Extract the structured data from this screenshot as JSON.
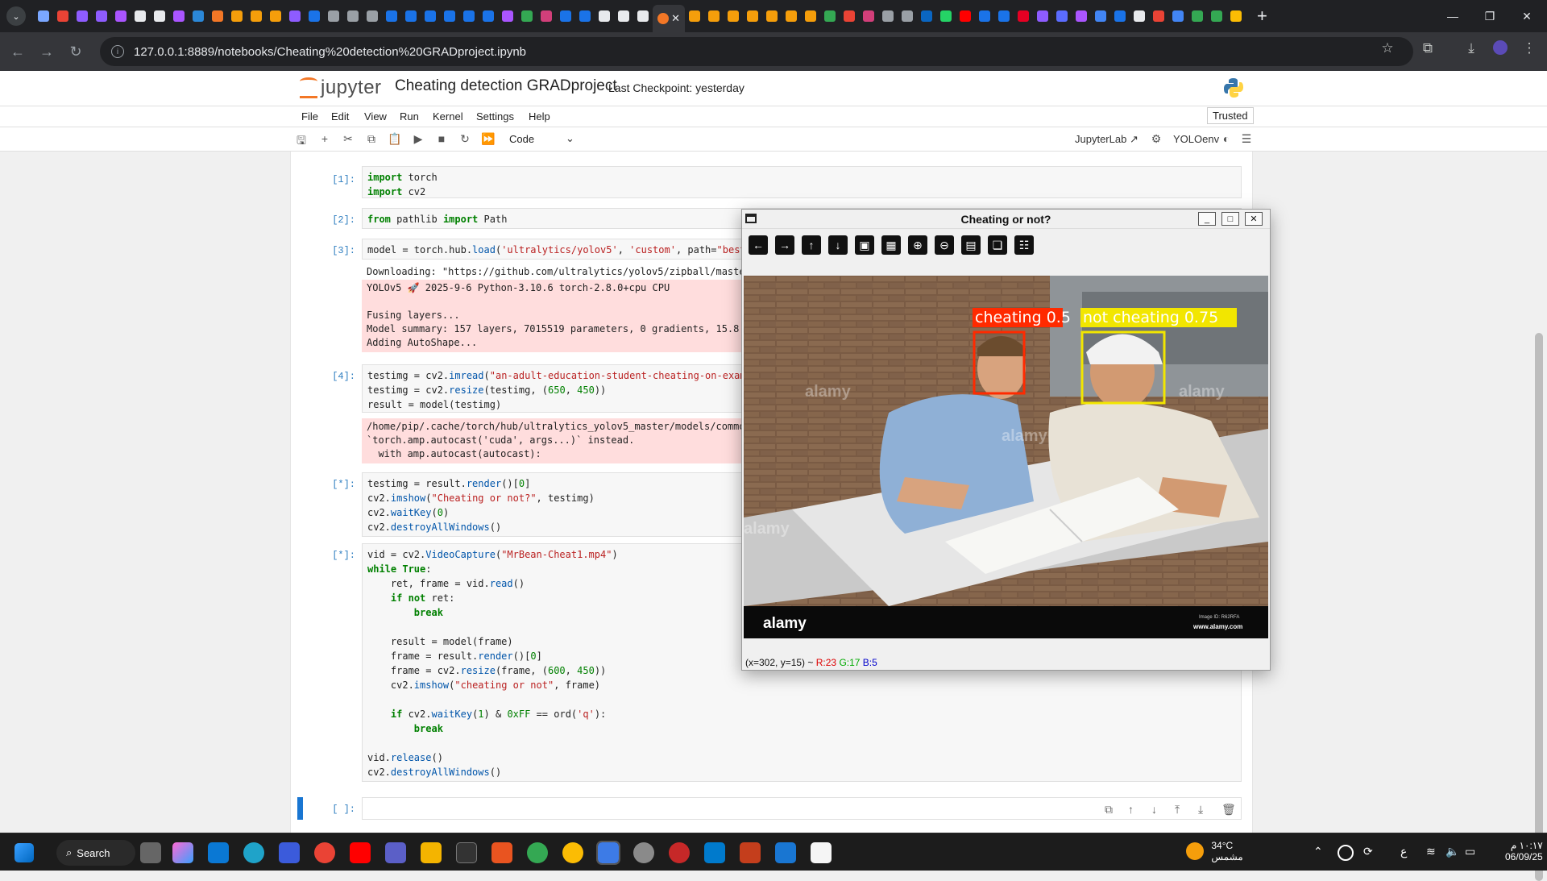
{
  "browser": {
    "url": "127.0.0.1:8889/notebooks/Cheating%20detection%20GRADproject.ipynb",
    "tab_icons": [
      "#7aa7ff",
      "#ea4335",
      "#8e5cff",
      "#8e5cff",
      "#aa55ff",
      "#e8eaed",
      "#e8eaed",
      "#aa55ff",
      "#2b88d8",
      "#f37726",
      "#f59e0b",
      "#f59e0b",
      "#f59e0b",
      "#8e5cff",
      "#1a73e8",
      "#9aa0a6",
      "#9aa0a6",
      "#9aa0a6",
      "#1a73e8",
      "#1a73e8",
      "#1a73e8",
      "#1a73e8",
      "#1a73e8",
      "#1a73e8",
      "#aa55ff",
      "#34a853",
      "#d23f7a",
      "#1a73e8",
      "#1a73e8",
      "#e8eaed",
      "#e8eaed",
      "#e8eaed"
    ],
    "right_tab_icons": [
      "#f59e0b",
      "#f59e0b",
      "#f59e0b",
      "#f59e0b",
      "#f59e0b",
      "#f59e0b",
      "#f59e0b",
      "#34a853",
      "#ea4335",
      "#d23f7a",
      "#9aa0a6",
      "#9aa0a6",
      "#0a66c2",
      "#25d366",
      "#ff0000",
      "#1a73e8",
      "#1a73e8",
      "#e60023",
      "#8e5cff",
      "#5b6cff",
      "#aa55ff",
      "#4285f4",
      "#1a73e8",
      "#e8eaed",
      "#ea4335",
      "#4285f4",
      "#34a853",
      "#34a853",
      "#fbbc04"
    ]
  },
  "jupyter": {
    "logo_text": "jupyter",
    "notebook_title": "Cheating detection GRADproject",
    "checkpoint": "Last Checkpoint: yesterday",
    "menus": [
      "File",
      "Edit",
      "View",
      "Run",
      "Kernel",
      "Settings",
      "Help"
    ],
    "trusted": "Trusted",
    "cell_type": "Code",
    "jupyterlab_link": "JupyterLab",
    "kernel_name": "YOLOenv"
  },
  "cells": {
    "c1": {
      "prompt": "[1]:",
      "code": [
        "import torch",
        "import cv2"
      ]
    },
    "c2": {
      "prompt": "[2]:",
      "code": [
        "from pathlib import Path"
      ]
    },
    "c3": {
      "prompt": "[3]:",
      "code": "model = torch.hub.load('ultralytics/yolov5', 'custom', path=\"best",
      "out_download": "Downloading: \"https://github.com/ultralytics/yolov5/zipball/maste",
      "out_lines": [
        "YOLOv5 🚀 2025-9-6 Python-3.10.6 torch-2.8.0+cpu CPU",
        "",
        "Fusing layers...",
        "Model summary: 157 layers, 7015519 parameters, 0 gradients, 15.8",
        "Adding AutoShape..."
      ]
    },
    "c4": {
      "prompt": "[4]:",
      "code": [
        "testimg = cv2.imread(\"an-adult-education-student-cheating-on-exam",
        "testimg = cv2.resize(testimg, (650, 450))",
        "result = model(testimg)"
      ],
      "out_lines": [
        "/home/pip/.cache/torch/hub/ultralytics_yolov5_master/models/commo",
        "`torch.amp.autocast('cuda', args...)` instead.",
        "  with amp.autocast(autocast):"
      ]
    },
    "c5": {
      "prompt": "[*]:",
      "code": [
        "testimg = result.render()[0]",
        "cv2.imshow(\"Cheating or not?\", testimg)",
        "cv2.waitKey(0)",
        "cv2.destroyAllWindows()"
      ]
    },
    "c6": {
      "prompt": "[*]:",
      "code": [
        "vid = cv2.VideoCapture(\"MrBean-Cheat1.mp4\")",
        "while True:",
        "    ret, frame = vid.read()",
        "    if not ret:",
        "        break",
        "",
        "    result = model(frame)",
        "    frame = result.render()[0]",
        "    frame = cv2.resize(frame, (600, 450))",
        "    cv2.imshow(\"cheating or not\", frame)",
        "",
        "    if cv2.waitKey(1) & 0xFF == ord('q'):",
        "        break",
        "",
        "vid.release()",
        "cv2.destroyAllWindows()"
      ]
    },
    "c7": {
      "prompt": "[ ]:"
    }
  },
  "cv_window": {
    "title": "Cheating or not?",
    "tool_icons": [
      "arrow-left-icon",
      "arrow-right-icon",
      "arrow-up-icon",
      "arrow-down-icon",
      "image-icon",
      "image-settings-icon",
      "zoom-in-icon",
      "zoom-out-icon",
      "save-icon",
      "copy-icon",
      "properties-icon"
    ],
    "detections": [
      {
        "label": "cheating 0.5",
        "color": "#ff2a00"
      },
      {
        "label": "not cheating 0.75",
        "color": "#f2e600"
      }
    ],
    "watermark": "alamy",
    "image_id": "Image ID: R62RFA",
    "image_site": "www.alamy.com",
    "status": {
      "coords": "(x=302, y=15) ~",
      "r": "R:23",
      "g": "G:17",
      "b": "B:5"
    }
  },
  "taskbar": {
    "search": "Search",
    "weather_temp": "34°C",
    "weather_desc": "مشمس",
    "time": "١٠:١٧ م",
    "date": "06/09/25",
    "lang": "ع"
  }
}
